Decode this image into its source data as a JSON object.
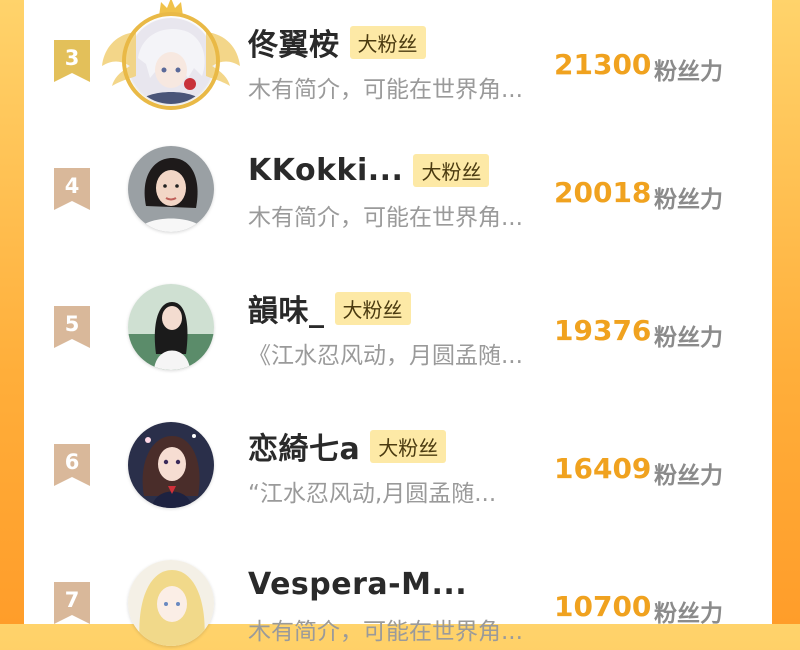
{
  "ranking": [
    {
      "rank": "3",
      "name": "佟翼桉",
      "badge": "大粉丝",
      "intro": "木有简介，可能在世界角...",
      "score": "21300",
      "score_label": "粉丝力",
      "avatar_icon": "user-avatar-anime-icon",
      "frame": "gold-winged-frame"
    },
    {
      "rank": "4",
      "name": "KKokki...",
      "badge": "大粉丝",
      "intro": "木有简介，可能在世界角...",
      "score": "20018",
      "score_label": "粉丝力",
      "avatar_icon": "user-avatar-photo-icon"
    },
    {
      "rank": "5",
      "name": "韻味_",
      "badge": "大粉丝",
      "intro": "《江水忍风动，月圆孟随...",
      "score": "19376",
      "score_label": "粉丝力",
      "avatar_icon": "user-avatar-photo-icon"
    },
    {
      "rank": "6",
      "name": "恋綺七a",
      "badge": "大粉丝",
      "intro": "“江水忍风动,月圆孟随...",
      "score": "16409",
      "score_label": "粉丝力",
      "avatar_icon": "user-avatar-photo-icon"
    },
    {
      "rank": "7",
      "name": "Vespera-M...",
      "badge": "",
      "intro": "木有简介，可能在世界角...",
      "score": "10700",
      "score_label": "粉丝力",
      "avatar_icon": "user-avatar-anime-icon"
    }
  ],
  "colors": {
    "background_gradient_top": "#ffd36b",
    "background_gradient_bottom": "#ff9d2a",
    "score": "#f0a21f",
    "badge_bg": "#fde9a6",
    "rank_badge_top3": "#e3c05a",
    "rank_badge_other": "#d9b89a"
  }
}
